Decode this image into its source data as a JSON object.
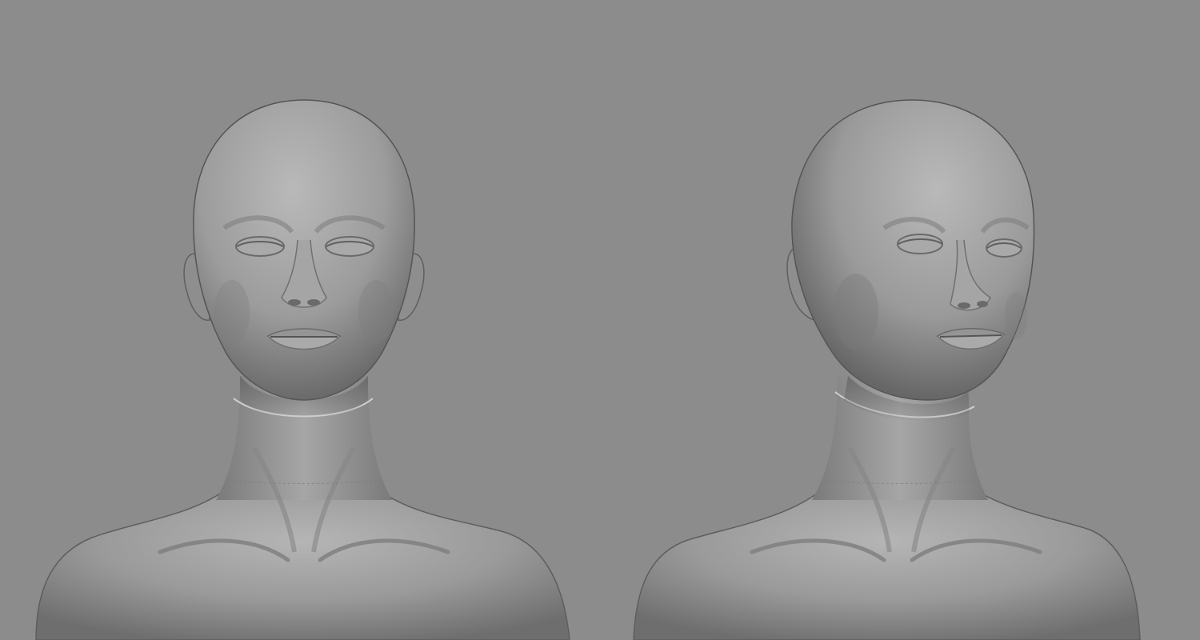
{
  "scene": {
    "background_color": "#8c8c8c",
    "material_color": "#9a9a9a",
    "models": [
      {
        "view": "front",
        "icon": "sculpt-bust-front"
      },
      {
        "view": "three-quarter",
        "icon": "sculpt-bust-three-quarter"
      }
    ]
  }
}
